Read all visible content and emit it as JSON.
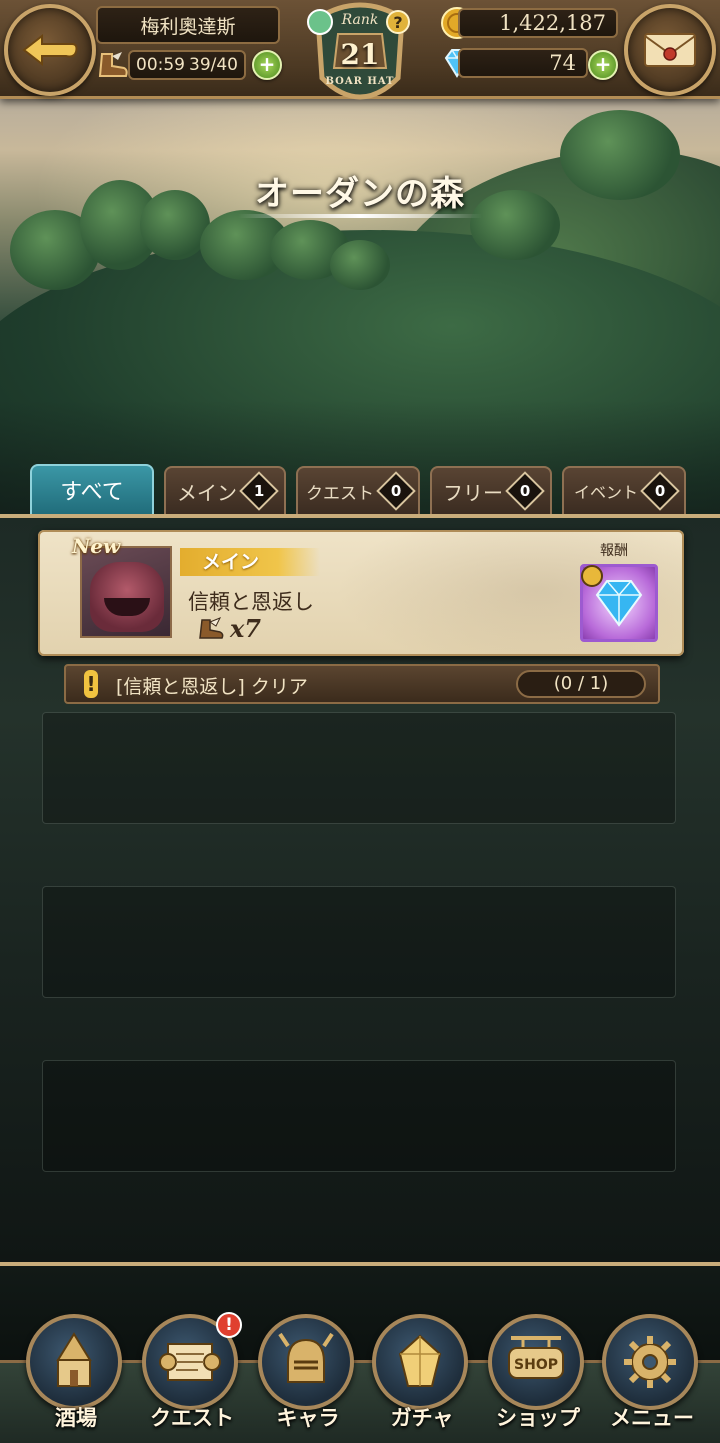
{
  "header": {
    "player_name": "梅利奧達斯",
    "stamina_timer": "00:59",
    "stamina": "39/40",
    "rank_label": "Rank",
    "rank_value": "21",
    "rank_sub": "BOAR HAT",
    "gold": "1,422,187",
    "gems": "74",
    "plus_label": "+",
    "help_label": "?"
  },
  "area": {
    "title": "オーダンの森"
  },
  "tabs": [
    {
      "label": "すべて",
      "count": null,
      "active": true
    },
    {
      "label": "メイン",
      "count": "1",
      "active": false
    },
    {
      "label": "クエスト",
      "count": "0",
      "active": false
    },
    {
      "label": "フリー",
      "count": "0",
      "active": false
    },
    {
      "label": "イベント",
      "count": "0",
      "active": false
    }
  ],
  "quest": {
    "new_label": "New",
    "category": "メイン",
    "name": "信頼と恩返し",
    "cost": "x7",
    "reward_label": "報酬",
    "mission_text": "[信頼と恩返し] クリア",
    "mission_progress": "(0 / 1)"
  },
  "nav": [
    {
      "label": "酒場",
      "icon": "tavern-icon"
    },
    {
      "label": "クエスト",
      "icon": "scroll-icon",
      "badge": "!"
    },
    {
      "label": "キャラ",
      "icon": "helmet-icon"
    },
    {
      "label": "ガチャ",
      "icon": "crystal-icon"
    },
    {
      "label": "ショップ",
      "icon": "shop-sign-icon"
    },
    {
      "label": "メニュー",
      "icon": "gear-icon"
    }
  ],
  "colors": {
    "tab_active": "#216d7b",
    "frame_gold": "#c9ad7b",
    "category_ribbon": "#e3ad2e",
    "reward_frame": "#9d5ad0"
  }
}
